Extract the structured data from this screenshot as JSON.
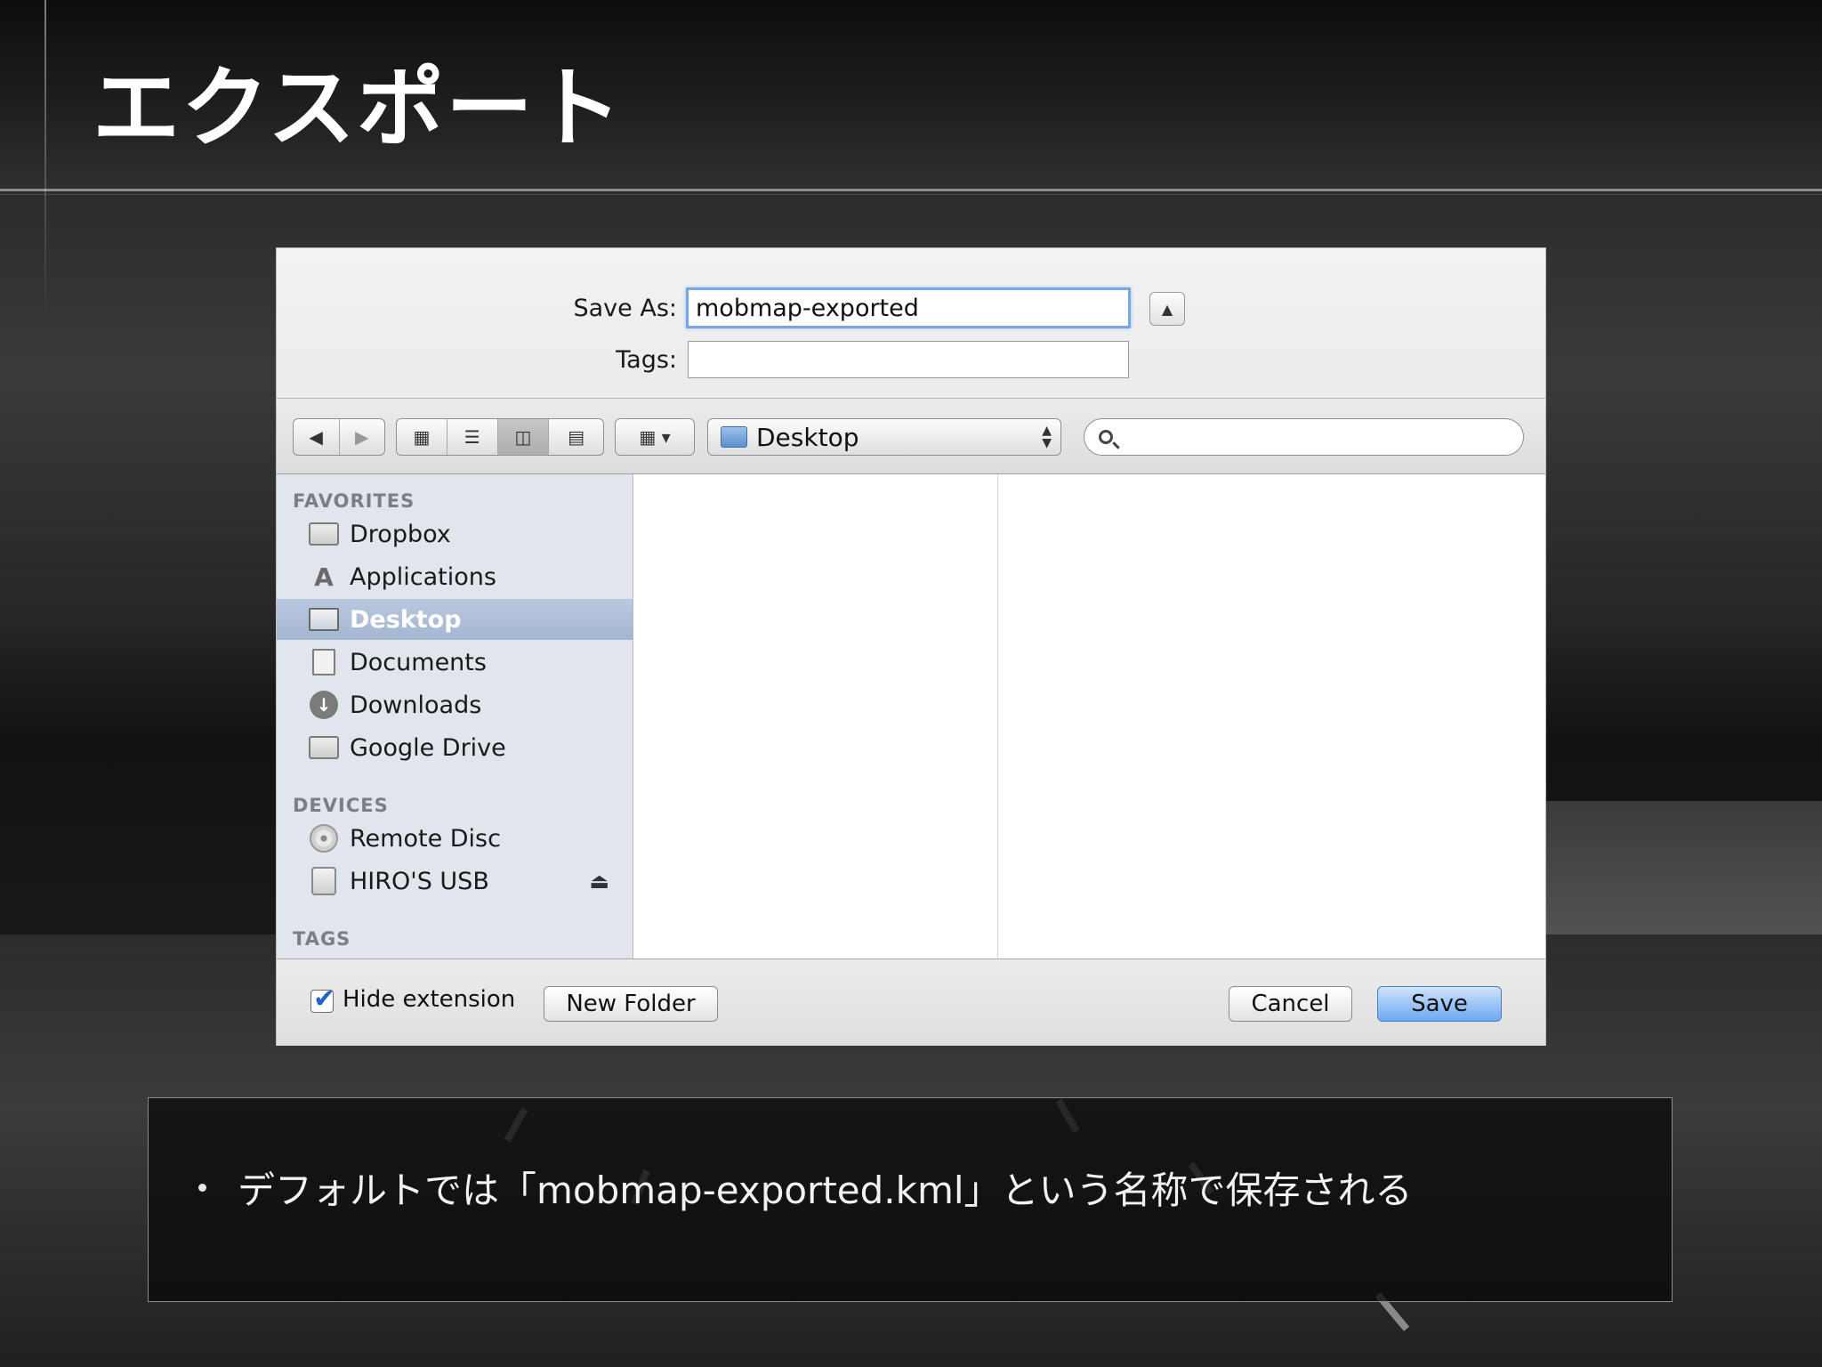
{
  "slide": {
    "title": "エクスポート",
    "caption": "デフォルトでは「mobmap-exported.kml」という名称で保存される"
  },
  "dialog": {
    "save_as_label": "Save As:",
    "save_as_value": "mobmap-exported",
    "tags_label": "Tags:",
    "tags_value": "",
    "expand_icon": "triangle-up-icon",
    "toolbar": {
      "back_icon": "back-arrow-icon",
      "forward_icon": "forward-arrow-icon",
      "view_modes": [
        "icon-view-icon",
        "list-view-icon",
        "column-view-icon",
        "coverflow-view-icon"
      ],
      "active_view": "column-view-icon",
      "arrange_icon": "arrange-icon",
      "location": "Desktop",
      "search_placeholder": ""
    },
    "sidebar": {
      "favorites_heading": "FAVORITES",
      "favorites": [
        {
          "label": "Dropbox",
          "icon": "folder-icon"
        },
        {
          "label": "Applications",
          "icon": "applications-icon"
        },
        {
          "label": "Desktop",
          "icon": "desktop-icon",
          "selected": true
        },
        {
          "label": "Documents",
          "icon": "documents-icon"
        },
        {
          "label": "Downloads",
          "icon": "downloads-icon"
        },
        {
          "label": "Google Drive",
          "icon": "folder-icon"
        }
      ],
      "devices_heading": "DEVICES",
      "devices": [
        {
          "label": "Remote Disc",
          "icon": "disc-icon"
        },
        {
          "label": "HIRO'S USB",
          "icon": "usb-drive-icon",
          "eject": true
        }
      ],
      "tags_heading": "TAGS"
    },
    "bottom": {
      "hide_extension_label": "Hide extension",
      "hide_extension_checked": true,
      "new_folder_label": "New Folder",
      "cancel_label": "Cancel",
      "save_label": "Save"
    }
  }
}
